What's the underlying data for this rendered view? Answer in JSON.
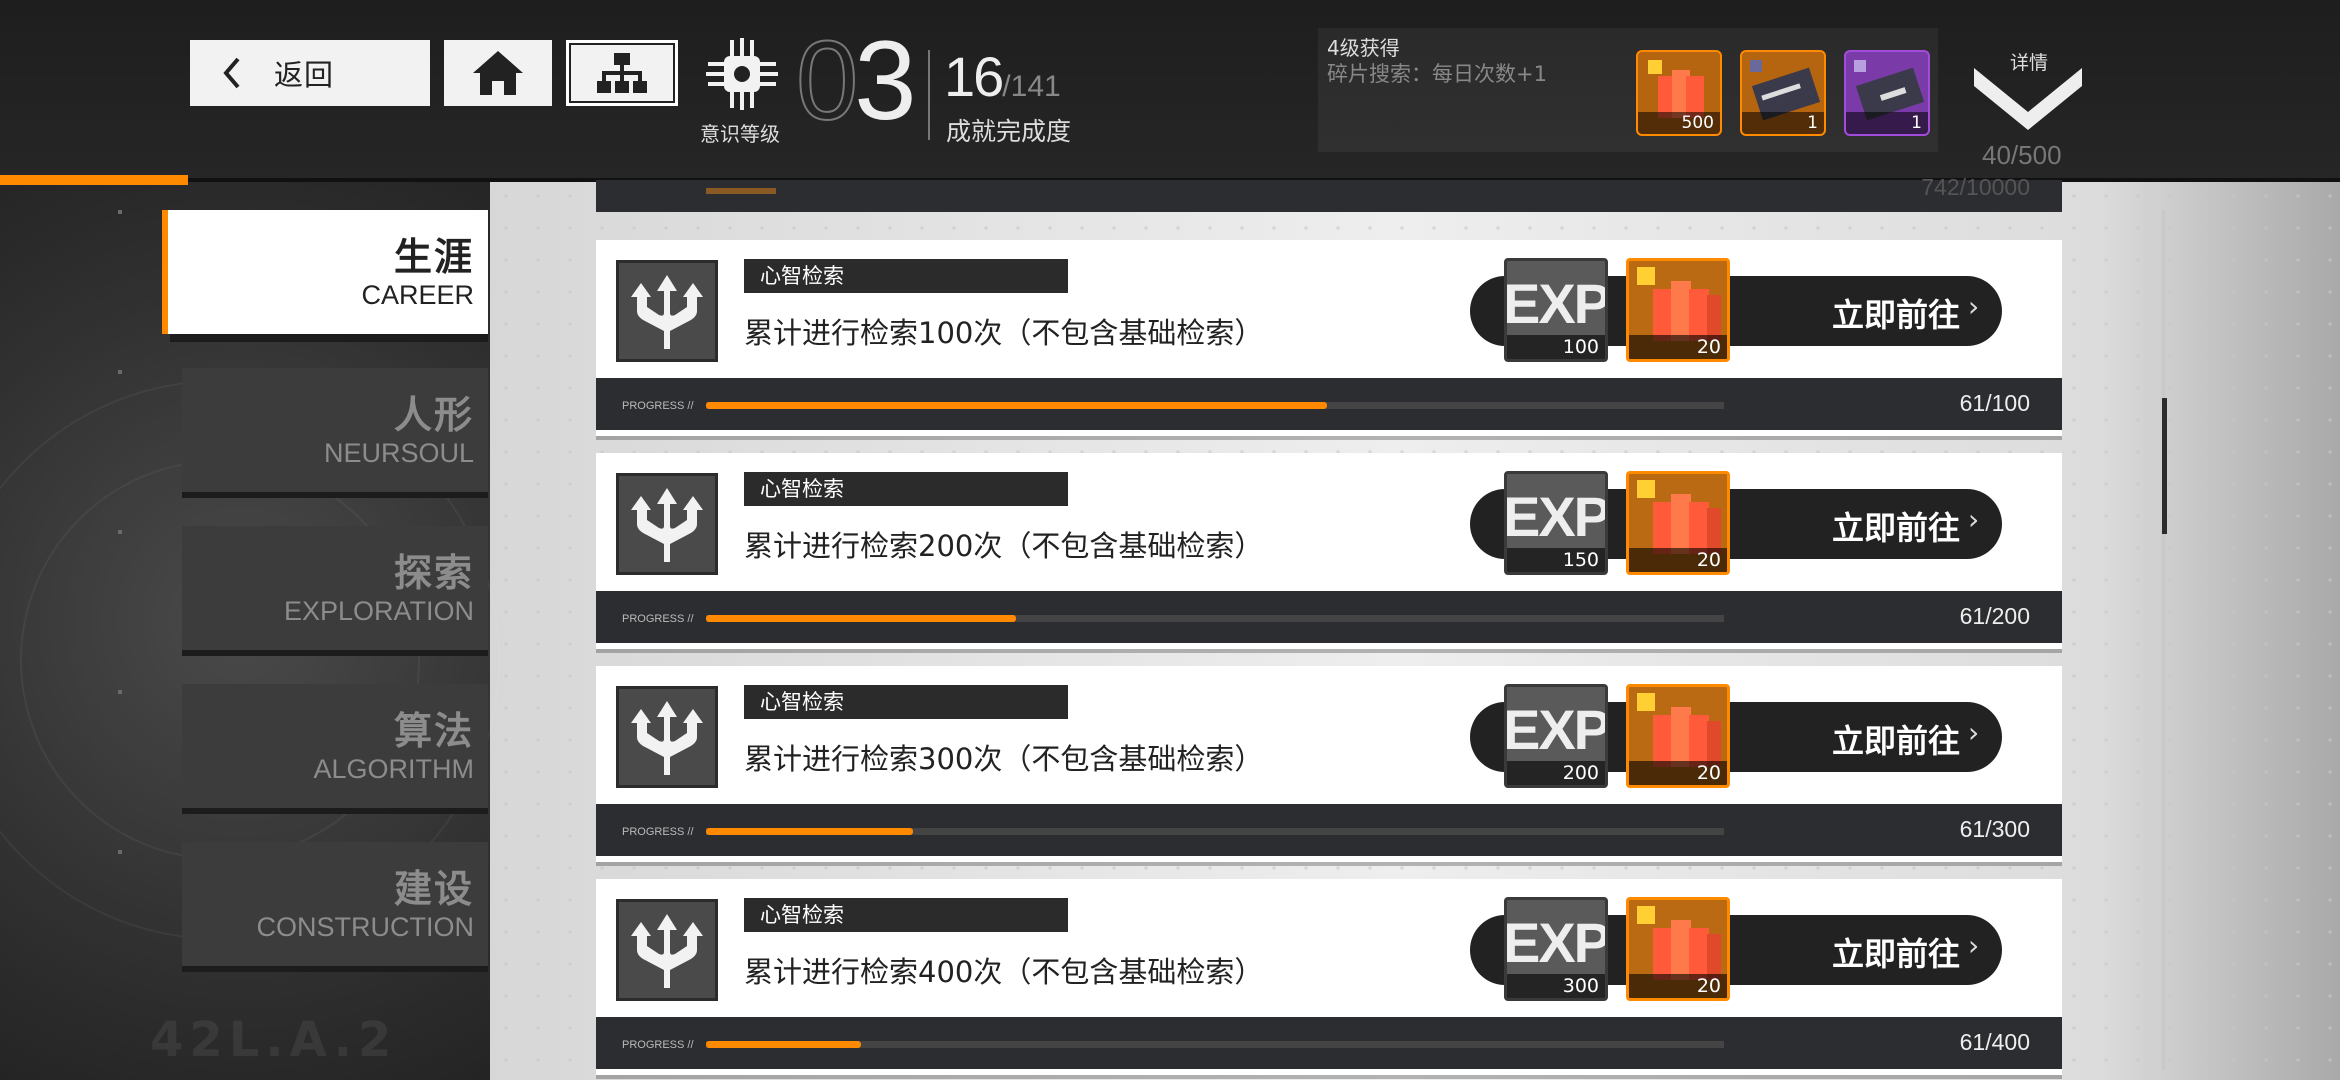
{
  "header": {
    "back_label": "返回",
    "level_label": "意识等级",
    "level_digit_outline": "0",
    "level_digit": "3",
    "achievement_current": "16",
    "achievement_total": "/141",
    "achievement_label": "成就完成度",
    "reward_title": "4级获得",
    "reward_desc": "碎片搜索：每日次数+1",
    "reward_items": [
      {
        "icon": "fragment-icon",
        "qty": "500",
        "color": "#ff8a00"
      },
      {
        "icon": "instruction-card-icon",
        "qty": "1",
        "color": "#ff8a00"
      },
      {
        "icon": "basic-card-icon",
        "qty": "1",
        "color": "#a24cdb"
      }
    ],
    "detail_label": "详情",
    "detail_count": "40/500"
  },
  "sidebar": {
    "items": [
      {
        "cn": "生涯",
        "en": "CAREER",
        "active": true
      },
      {
        "cn": "人形",
        "en": "NEURSOUL",
        "active": false
      },
      {
        "cn": "探索",
        "en": "EXPLORATION",
        "active": false
      },
      {
        "cn": "算法",
        "en": "ALGORITHM",
        "active": false
      },
      {
        "cn": "建设",
        "en": "CONSTRUCTION",
        "active": false
      }
    ],
    "watermark": "42L.A.2"
  },
  "partial_card": {
    "progress_text": "742/10000"
  },
  "cards": [
    {
      "tag": "心智检索",
      "desc": "累计进行检索100次（不包含基础检索）",
      "exp_label": "EXP",
      "exp_qty": "100",
      "frag_qty": "20",
      "goto": "立即前往",
      "arrow": "›",
      "progress_label": "PROGRESS //",
      "progress_text": "61/100",
      "progress": 0.61
    },
    {
      "tag": "心智检索",
      "desc": "累计进行检索200次（不包含基础检索）",
      "exp_label": "EXP",
      "exp_qty": "150",
      "frag_qty": "20",
      "goto": "立即前往",
      "arrow": "›",
      "progress_label": "PROGRESS //",
      "progress_text": "61/200",
      "progress": 0.305
    },
    {
      "tag": "心智检索",
      "desc": "累计进行检索300次（不包含基础检索）",
      "exp_label": "EXP",
      "exp_qty": "200",
      "frag_qty": "20",
      "goto": "立即前往",
      "arrow": "›",
      "progress_label": "PROGRESS //",
      "progress_text": "61/300",
      "progress": 0.2033
    },
    {
      "tag": "心智检索",
      "desc": "累计进行检索400次（不包含基础检索）",
      "exp_label": "EXP",
      "exp_qty": "300",
      "frag_qty": "20",
      "goto": "立即前往",
      "arrow": "›",
      "progress_label": "PROGRESS //",
      "progress_text": "61/400",
      "progress": 0.1525
    }
  ],
  "colors": {
    "accent": "#ff8a00",
    "dark": "#2c2d30",
    "purple": "#a24cdb"
  }
}
